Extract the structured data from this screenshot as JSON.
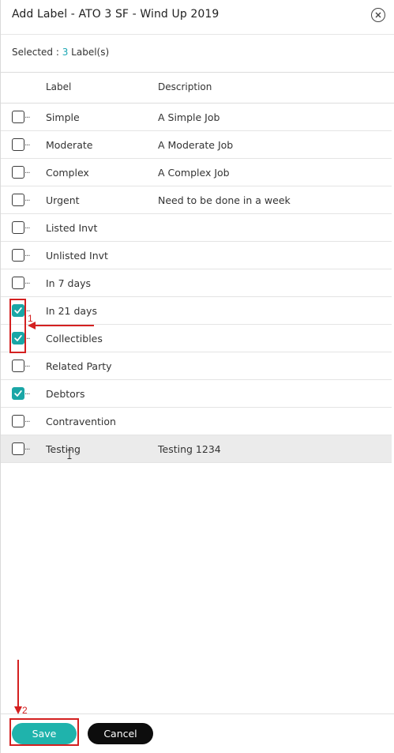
{
  "dialog": {
    "title": "Add Label - ATO 3 SF - Wind Up 2019",
    "close_icon": "close-circle-icon"
  },
  "selection": {
    "prefix": "Selected : ",
    "count": "3",
    "suffix": " Label(s)"
  },
  "table": {
    "columns": [
      "Label",
      "Description"
    ],
    "rows": [
      {
        "label": "Simple",
        "description": "A Simple Job",
        "checked": false
      },
      {
        "label": "Moderate",
        "description": "A Moderate Job",
        "checked": false
      },
      {
        "label": "Complex",
        "description": "A Complex Job",
        "checked": false
      },
      {
        "label": "Urgent",
        "description": "Need to be done in a week",
        "checked": false
      },
      {
        "label": "Listed Invt",
        "description": "",
        "checked": false
      },
      {
        "label": "Unlisted Invt",
        "description": "",
        "checked": false
      },
      {
        "label": "In 7 days",
        "description": "",
        "checked": false
      },
      {
        "label": "In 21 days",
        "description": "",
        "checked": true
      },
      {
        "label": "Collectibles",
        "description": "",
        "checked": true
      },
      {
        "label": "Related Party",
        "description": "",
        "checked": false
      },
      {
        "label": "Debtors",
        "description": "",
        "checked": true
      },
      {
        "label": "Contravention",
        "description": "",
        "checked": false
      },
      {
        "label": "Testing",
        "description": "Testing 1234",
        "checked": false,
        "hovered": true
      }
    ]
  },
  "footer": {
    "save_label": "Save",
    "cancel_label": "Cancel"
  },
  "annotations": {
    "step1": "1",
    "step2": "2",
    "color": "#d42020"
  },
  "colors": {
    "accent": "#1aa6a6",
    "save_button": "#1fb3ac",
    "cancel_button": "#0d0d0d"
  }
}
